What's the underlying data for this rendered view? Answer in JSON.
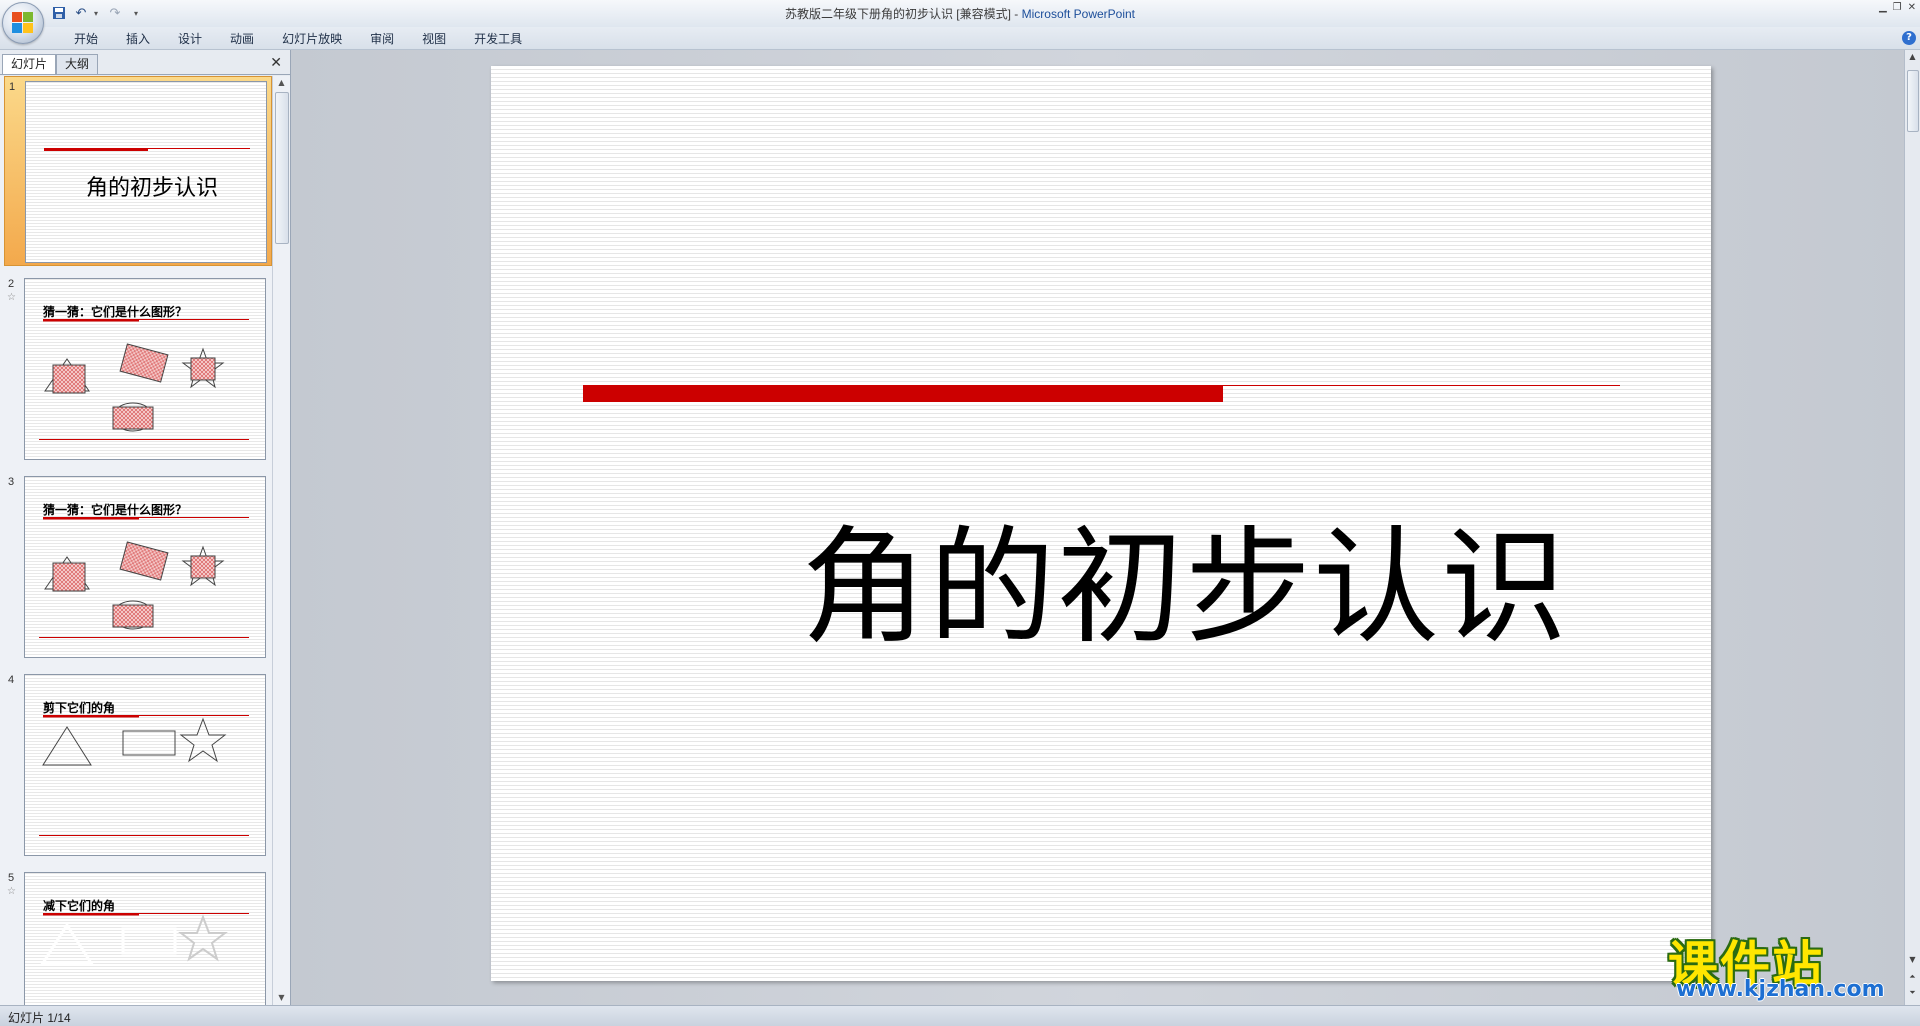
{
  "window": {
    "title_doc": "苏教版二年级下册角的初步认识 [兼容模式] - ",
    "title_app": "Microsoft PowerPoint",
    "controls": [
      "▁",
      "❐",
      "✕"
    ]
  },
  "ribbon": {
    "tabs": [
      "开始",
      "插入",
      "设计",
      "动画",
      "幻灯片放映",
      "审阅",
      "视图",
      "开发工具"
    ]
  },
  "pane": {
    "tab_slides": "幻灯片",
    "tab_outline": "大纲",
    "close": "✕"
  },
  "thumbnails": [
    {
      "num": "1",
      "title": "",
      "big_text": "角的初步认识",
      "selected": true
    },
    {
      "num": "2",
      "title": "猜一猜：它们是什么图形？",
      "has_anim": true
    },
    {
      "num": "3",
      "title": "猜一猜：它们是什么图形？"
    },
    {
      "num": "4",
      "title": "剪下它们的角"
    },
    {
      "num": "5",
      "title": "减下它们的角",
      "has_anim": true
    }
  ],
  "slide": {
    "title": "角的初步认识"
  },
  "status": {
    "slide_counter": "幻灯片 1/14"
  },
  "watermark": {
    "cn": "课件站",
    "url": "www.kjzhan.com"
  },
  "colors": {
    "accent_red": "#cc0000",
    "selection_orange": "#f3a94c"
  }
}
